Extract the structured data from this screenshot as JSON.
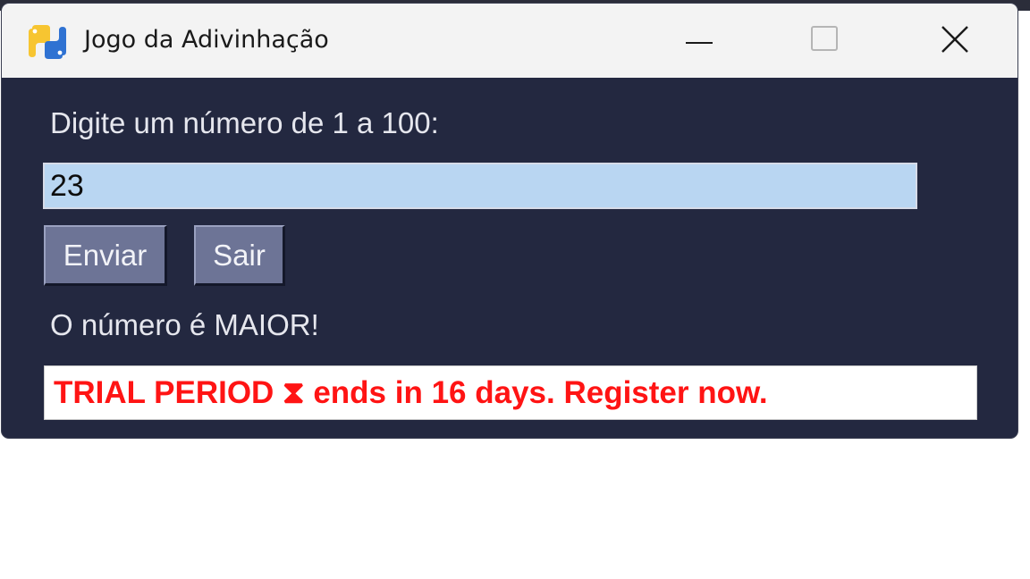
{
  "window": {
    "title": "Jogo da Adivinhação"
  },
  "titlebar": {
    "app_icon": "python-logo-icon",
    "controls": [
      "minimize-icon",
      "maximize-icon",
      "close-icon"
    ]
  },
  "form": {
    "prompt": "Digite um número de 1 a 100:",
    "guess_value": "23",
    "submit_label": "Enviar",
    "exit_label": "Sair",
    "feedback": "O número é MAIOR!"
  },
  "trial_banner": {
    "text": "TRIAL PERIOD ⧗ ends in 16 days. Register now."
  },
  "colors": {
    "window_background": "#232840",
    "titlebar": "#f3f3f3",
    "input_background": "#b9d6f2",
    "button": "#6d7496",
    "trial_text": "#ff1414"
  }
}
